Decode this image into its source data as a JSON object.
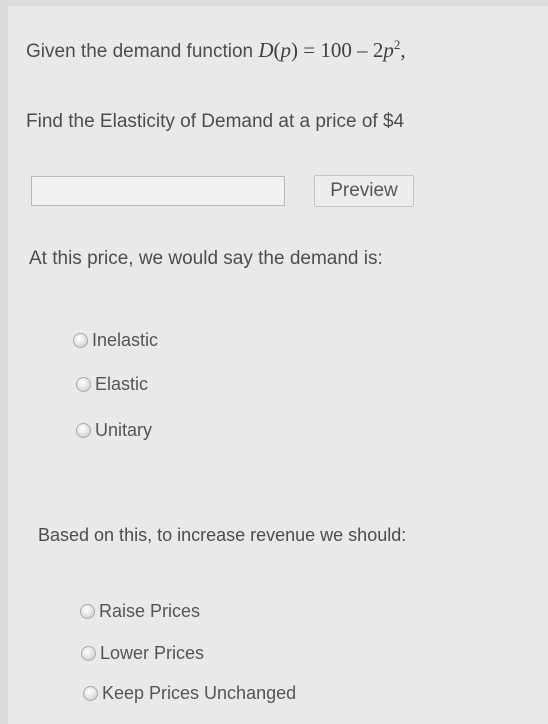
{
  "question": {
    "intro": "Given the demand function",
    "function": {
      "lhs": "D",
      "arg": "p",
      "equals": "=",
      "constant": "100",
      "minus": "–",
      "coef": "2",
      "var": "p",
      "exp": "2",
      "trail": ","
    },
    "prompt": "Find the Elasticity of Demand at a price of $4"
  },
  "answer": {
    "value": "",
    "placeholder": ""
  },
  "preview_label": "Preview",
  "demand_question": "At this price, we would say the demand is:",
  "demand_options": [
    "Inelastic",
    "Elastic",
    "Unitary"
  ],
  "revenue_question": "Based on this, to increase revenue we should:",
  "revenue_options": [
    "Raise Prices",
    "Lower Prices",
    "Keep Prices Unchanged"
  ]
}
